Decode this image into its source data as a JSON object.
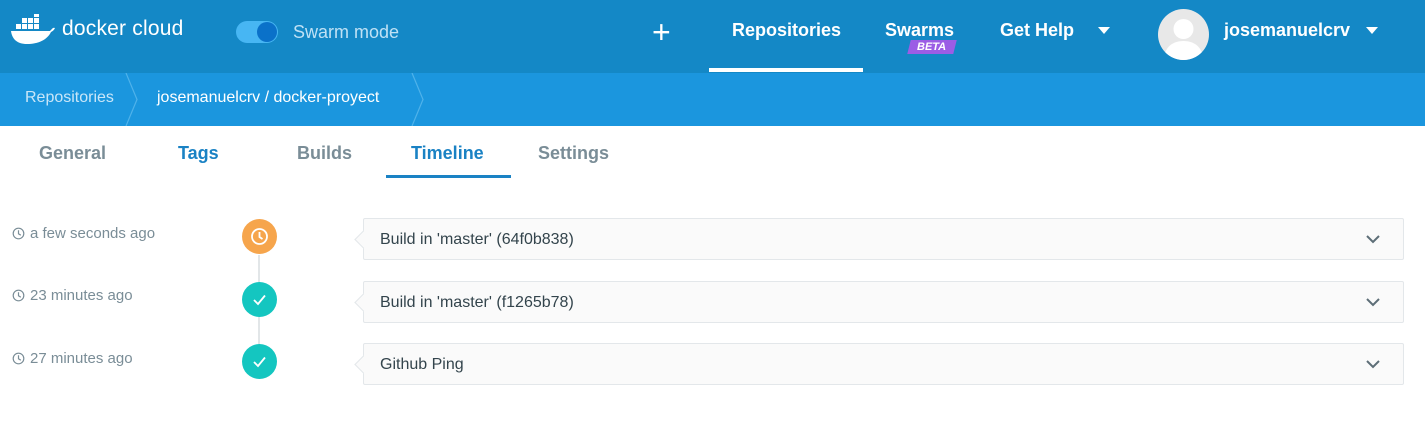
{
  "header": {
    "logo_text": "docker cloud",
    "swarm_mode_label": "Swarm mode",
    "swarm_mode_on": true,
    "add_label": "+",
    "nav": {
      "repositories": "Repositories",
      "swarms": "Swarms",
      "swarms_badge": "BETA",
      "get_help": "Get Help"
    },
    "username": "josemanuelcrv"
  },
  "breadcrumb": {
    "items": [
      "Repositories",
      "josemanuelcrv / docker-proyect"
    ]
  },
  "tabs": [
    "General",
    "Tags",
    "Builds",
    "Timeline",
    "Settings"
  ],
  "active_tab": "Timeline",
  "timeline": [
    {
      "time": "a few seconds ago",
      "status": "pending",
      "icon": "clock-icon",
      "label": "Build in 'master' (64f0b838)"
    },
    {
      "time": "23 minutes ago",
      "status": "success",
      "icon": "check-icon",
      "label": "Build in 'master' (f1265b78)"
    },
    {
      "time": "27 minutes ago",
      "status": "success",
      "icon": "check-icon",
      "label": "Github Ping"
    }
  ],
  "colors": {
    "topbar": "#1488c6",
    "breadcrumb": "#1b96de",
    "accent": "#1a82c4",
    "pending": "#f6a54c",
    "success": "#14c6c0",
    "beta_badge": "#9b5de5"
  }
}
